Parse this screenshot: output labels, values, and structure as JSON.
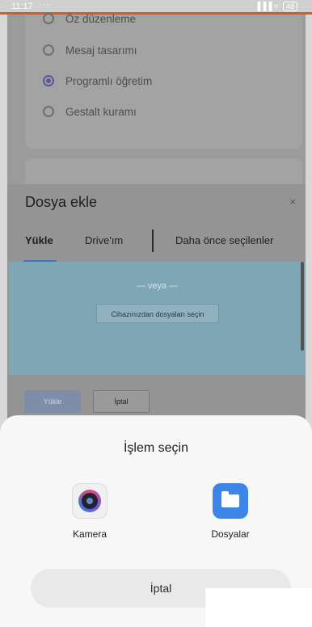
{
  "status_bar": {
    "time": "11:17",
    "dots": "···",
    "signal": "▐▐▐ ▿",
    "battery": "48"
  },
  "quiz": {
    "options": [
      {
        "label": "Öz düzenleme",
        "selected": false
      },
      {
        "label": "Mesaj tasarımı",
        "selected": false
      },
      {
        "label": "Programlı öğretim",
        "selected": true
      },
      {
        "label": "Gestalt kuramı",
        "selected": false
      }
    ]
  },
  "dialog": {
    "title": "Dosya ekle",
    "close": "×",
    "tabs": [
      {
        "label": "Yükle",
        "active": true
      },
      {
        "label": "Drive'ım",
        "active": false
      },
      {
        "label": "Daha önce seçilenler",
        "active": false
      }
    ],
    "upload_area": {
      "or_text": "— veya —",
      "pick_button": "Cihazınızdan dosyaları seçin"
    },
    "upload_button": "Yükle",
    "cancel_button": "İptal"
  },
  "sheet": {
    "title": "İşlem seçin",
    "apps": [
      {
        "label": "Kamera",
        "icon": "camera-icon"
      },
      {
        "label": "Dosyalar",
        "icon": "folder-icon"
      }
    ],
    "cancel": "İptal"
  },
  "colors": {
    "accent": "#3b7abe",
    "upload_area": "#7ea6b4",
    "files_blue": "#3d86e8",
    "status_accent": "#e0561e"
  }
}
